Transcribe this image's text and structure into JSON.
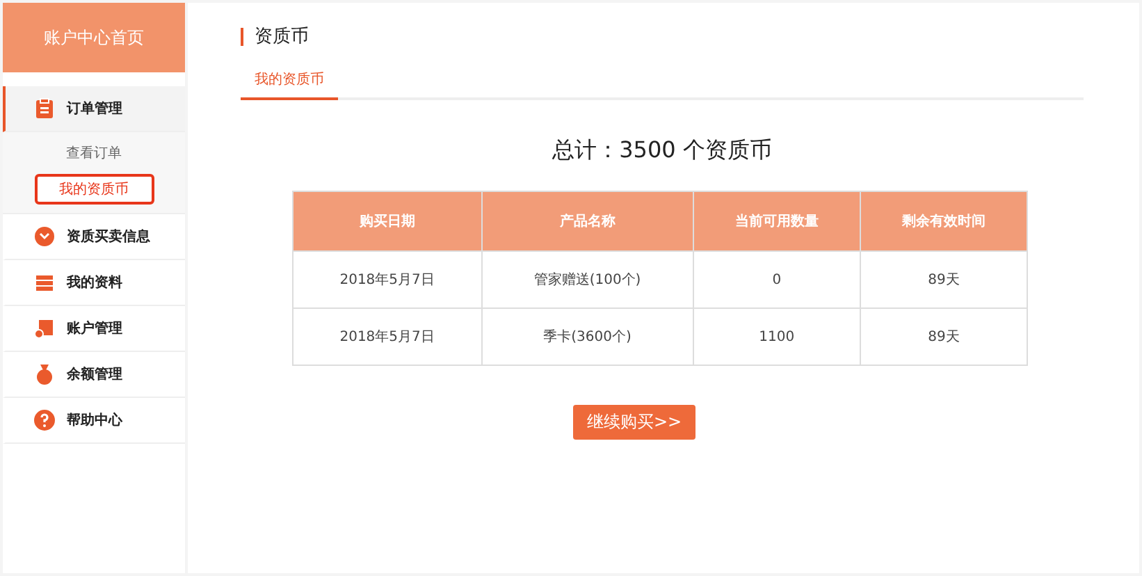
{
  "sidebar": {
    "header": "账户中心首页",
    "items": [
      {
        "label": "订单管理",
        "expanded": true,
        "children": [
          {
            "label": "查看订单",
            "selected": false
          },
          {
            "label": "我的资质币",
            "selected": true
          }
        ]
      },
      {
        "label": "资质买卖信息",
        "expanded": false
      },
      {
        "label": "我的资料",
        "expanded": false
      },
      {
        "label": "账户管理",
        "expanded": false
      },
      {
        "label": "余额管理",
        "expanded": false
      },
      {
        "label": "帮助中心",
        "expanded": false
      }
    ]
  },
  "page_title": "资质币",
  "tabs": [
    {
      "label": "我的资质币",
      "selected": true
    }
  ],
  "total": "总计：3500 个资质币",
  "table": {
    "columns": [
      "购买日期",
      "产品名称",
      "当前可用数量",
      "剩余有效时间"
    ],
    "rows": [
      [
        "2018年5月7日",
        "管家赠送(100个)",
        "0",
        "89天"
      ],
      [
        "2018年5月7日",
        "季卡(3600个)",
        "1100",
        "89天"
      ]
    ]
  },
  "buy_button": "继续购买>>"
}
